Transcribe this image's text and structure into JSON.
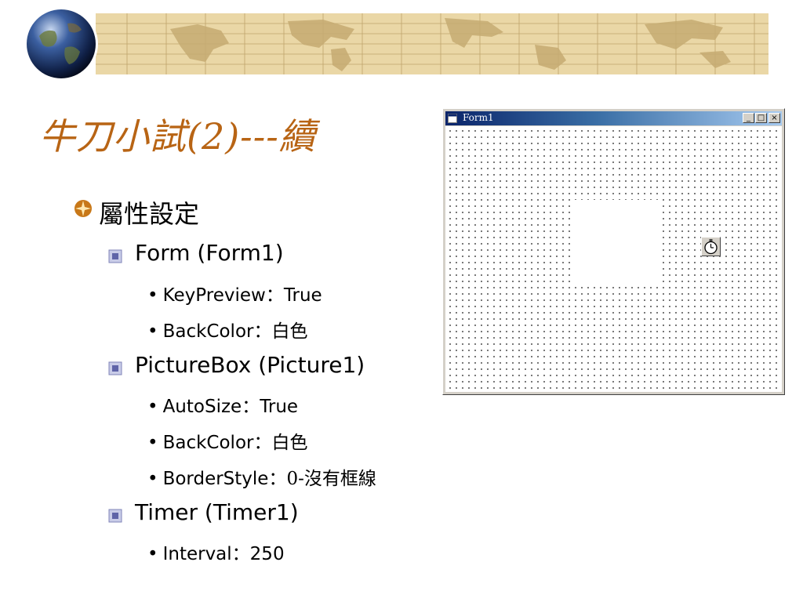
{
  "slide": {
    "title": "牛刀小試(2)---續",
    "heading": "屬性設定",
    "sections": [
      {
        "name": "Form (Form1)",
        "props": [
          {
            "key": "KeyPreview",
            "sep": "：",
            "value": "True"
          },
          {
            "key": "BackColor",
            "sep": "：",
            "value": "白色"
          }
        ]
      },
      {
        "name": "PictureBox (Picture1)",
        "props": [
          {
            "key": "AutoSize",
            "sep": "：",
            "value": "True"
          },
          {
            "key": "BackColor",
            "sep": "：",
            "value": "白色"
          },
          {
            "key": "BorderStyle",
            "sep": "：",
            "value": "0-沒有框線"
          }
        ]
      },
      {
        "name": "Timer (Timer1)",
        "props": [
          {
            "key": "Interval",
            "sep": "：",
            "value": "250"
          }
        ]
      }
    ]
  },
  "form_window": {
    "title": "Form1",
    "caption_buttons": [
      "_",
      "□",
      "×"
    ]
  },
  "colors": {
    "title": "#b86414",
    "bullet": "#c87818",
    "banner_bg": "#ead7a6"
  },
  "icons": {
    "globe": "globe-icon",
    "bullet1": "compass-bullet-icon",
    "bullet2": "square-bullet-icon",
    "timer": "stopwatch-icon",
    "form": "form-icon"
  }
}
